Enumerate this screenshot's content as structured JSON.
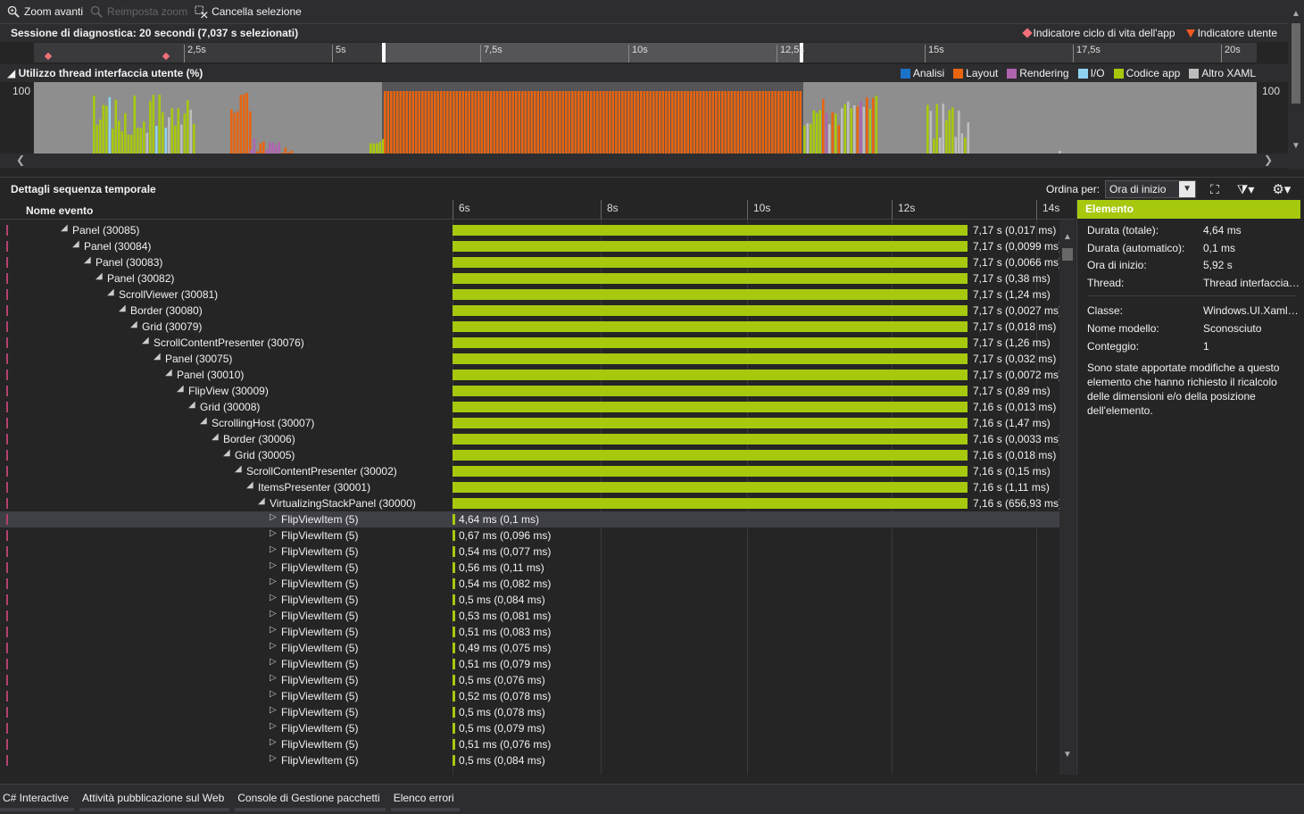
{
  "toolbar": {
    "zoom_in": "Zoom avanti",
    "reset_zoom": "Reimposta zoom",
    "clear_selection": "Cancella selezione"
  },
  "session": {
    "title": "Sessione di diagnostica: 20 secondi (7,037 s selezionati)",
    "legend_lifecycle": "Indicatore ciclo di vita dell'app",
    "legend_user": "Indicatore utente"
  },
  "ruler_ticks": [
    "2,5s",
    "5s",
    "7,5s",
    "10s",
    "12,5s",
    "15s",
    "17,5s",
    "20s"
  ],
  "ui_thread": {
    "title": "Utilizzo thread interfaccia utente (%)",
    "y_max_label": "100",
    "legend": [
      {
        "label": "Analisi",
        "color": "#1c74c9"
      },
      {
        "label": "Layout",
        "color": "#e8640f"
      },
      {
        "label": "Rendering",
        "color": "#b064b0"
      },
      {
        "label": "I/O",
        "color": "#8fd3f0"
      },
      {
        "label": "Codice app",
        "color": "#a6c90e"
      },
      {
        "label": "Altro XAML",
        "color": "#bdbdbd"
      }
    ]
  },
  "details": {
    "title": "Dettagli sequenza temporale",
    "sort_label": "Ordina per:",
    "sort_value": "Ora di inizio",
    "column_name": "Nome evento",
    "axis_ticks": [
      "6s",
      "8s",
      "10s",
      "12s",
      "14s"
    ]
  },
  "rows": [
    {
      "label": "Panel (30085)",
      "value": "7,17 s (0,017 ms)"
    },
    {
      "label": "Panel (30084)",
      "value": "7,17 s (0,0099 ms)"
    },
    {
      "label": "Panel (30083)",
      "value": "7,17 s (0,0066 ms)"
    },
    {
      "label": "Panel (30082)",
      "value": "7,17 s (0,38 ms)"
    },
    {
      "label": "ScrollViewer (30081)",
      "value": "7,17 s (1,24 ms)"
    },
    {
      "label": "Border (30080)",
      "value": "7,17 s (0,0027 ms)"
    },
    {
      "label": "Grid (30079)",
      "value": "7,17 s (0,018 ms)"
    },
    {
      "label": "ScrollContentPresenter (30076)",
      "value": "7,17 s (1,26 ms)"
    },
    {
      "label": "Panel (30075)",
      "value": "7,17 s (0,032 ms)"
    },
    {
      "label": "Panel (30010)",
      "value": "7,17 s (0,0072 ms)"
    },
    {
      "label": "FlipView (30009)",
      "value": "7,17 s (0,89 ms)"
    },
    {
      "label": "Grid (30008)",
      "value": "7,16 s (0,013 ms)"
    },
    {
      "label": "ScrollingHost (30007)",
      "value": "7,16 s (1,47 ms)"
    },
    {
      "label": "Border (30006)",
      "value": "7,16 s (0,0033 ms)"
    },
    {
      "label": "Grid (30005)",
      "value": "7,16 s (0,018 ms)"
    },
    {
      "label": "ScrollContentPresenter (30002)",
      "value": "7,16 s (0,15 ms)"
    },
    {
      "label": "ItemsPresenter (30001)",
      "value": "7,16 s (1,11 ms)"
    },
    {
      "label": "VirtualizingStackPanel (30000)",
      "value": "7,16 s (656,93 ms)"
    },
    {
      "label": "FlipViewItem (5)",
      "value": "4,64 ms (0,1 ms)"
    },
    {
      "label": "FlipViewItem (5)",
      "value": "0,67 ms (0,096 ms)"
    },
    {
      "label": "FlipViewItem (5)",
      "value": "0,54 ms (0,077 ms)"
    },
    {
      "label": "FlipViewItem (5)",
      "value": "0,56 ms (0,11 ms)"
    },
    {
      "label": "FlipViewItem (5)",
      "value": "0,54 ms (0,082 ms)"
    },
    {
      "label": "FlipViewItem (5)",
      "value": "0,5 ms (0,084 ms)"
    },
    {
      "label": "FlipViewItem (5)",
      "value": "0,53 ms (0,081 ms)"
    },
    {
      "label": "FlipViewItem (5)",
      "value": "0,51 ms (0,083 ms)"
    },
    {
      "label": "FlipViewItem (5)",
      "value": "0,49 ms (0,075 ms)"
    },
    {
      "label": "FlipViewItem (5)",
      "value": "0,51 ms (0,079 ms)"
    },
    {
      "label": "FlipViewItem (5)",
      "value": "0,5 ms (0,076 ms)"
    },
    {
      "label": "FlipViewItem (5)",
      "value": "0,52 ms (0,078 ms)"
    },
    {
      "label": "FlipViewItem (5)",
      "value": "0,5 ms (0,078 ms)"
    },
    {
      "label": "FlipViewItem (5)",
      "value": "0,5 ms (0,079 ms)"
    },
    {
      "label": "FlipViewItem (5)",
      "value": "0,51 ms (0,076 ms)"
    },
    {
      "label": "FlipViewItem (5)",
      "value": "0,5 ms (0,084 ms)"
    }
  ],
  "properties": {
    "header": "Elemento",
    "items": [
      {
        "key": "Durata (totale):",
        "value": "4,64 ms"
      },
      {
        "key": "Durata (automatico):",
        "value": "0,1 ms"
      },
      {
        "key": "Ora di inizio:",
        "value": "5,92 s"
      },
      {
        "key": "Thread:",
        "value": "Thread interfaccia utente"
      },
      {
        "key": "Classe:",
        "value": "Windows.UI.Xaml.Controls.FlipViewItem"
      },
      {
        "key": "Nome modello:",
        "value": "Sconosciuto"
      },
      {
        "key": "Conteggio:",
        "value": "1"
      }
    ],
    "description": "Sono state apportate modifiche a questo elemento che hanno richiesto il ricalcolo delle dimensioni e/o della posizione dell'elemento."
  },
  "bottom_tabs": [
    "C# Interactive",
    "Attività pubblicazione sul Web",
    "Console di Gestione pacchetti",
    "Elenco errori"
  ]
}
